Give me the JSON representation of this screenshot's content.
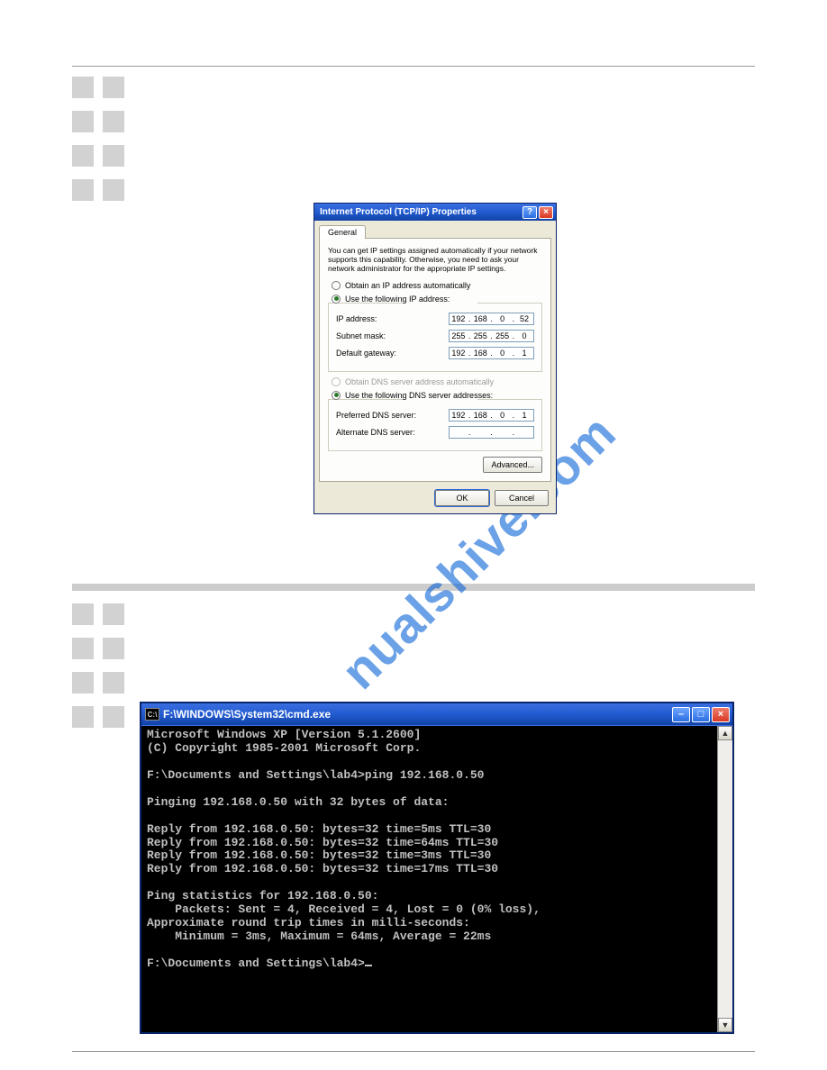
{
  "watermark": "nualshive.com",
  "tcpip": {
    "title": "Internet Protocol (TCP/IP) Properties",
    "tab": "General",
    "intro": "You can get IP settings assigned automatically if your network supports this capability. Otherwise, you need to ask your network administrator for the appropriate IP settings.",
    "r_obtain": "Obtain an IP address automatically",
    "r_usefollowing": "Use the following IP address:",
    "f_ip": "IP address:",
    "v_ip": [
      "192",
      "168",
      "0",
      "52"
    ],
    "f_mask": "Subnet mask:",
    "v_mask": [
      "255",
      "255",
      "255",
      "0"
    ],
    "f_gw": "Default gateway:",
    "v_gw": [
      "192",
      "168",
      "0",
      "1"
    ],
    "r_obtaindns": "Obtain DNS server address automatically",
    "r_usedns": "Use the following DNS server addresses:",
    "f_pref": "Preferred DNS server:",
    "v_pref": [
      "192",
      "168",
      "0",
      "1"
    ],
    "f_alt": "Alternate DNS server:",
    "v_alt": [
      "",
      "",
      "",
      ""
    ],
    "advanced": "Advanced...",
    "ok": "OK",
    "cancel": "Cancel"
  },
  "cmd": {
    "title": "F:\\WINDOWS\\System32\\cmd.exe",
    "lines": [
      "Microsoft Windows XP [Version 5.1.2600]",
      "(C) Copyright 1985-2001 Microsoft Corp.",
      "",
      "F:\\Documents and Settings\\lab4>ping 192.168.0.50",
      "",
      "Pinging 192.168.0.50 with 32 bytes of data:",
      "",
      "Reply from 192.168.0.50: bytes=32 time=5ms TTL=30",
      "Reply from 192.168.0.50: bytes=32 time=64ms TTL=30",
      "Reply from 192.168.0.50: bytes=32 time=3ms TTL=30",
      "Reply from 192.168.0.50: bytes=32 time=17ms TTL=30",
      "",
      "Ping statistics for 192.168.0.50:",
      "    Packets: Sent = 4, Received = 4, Lost = 0 (0% loss),",
      "Approximate round trip times in milli-seconds:",
      "    Minimum = 3ms, Maximum = 64ms, Average = 22ms",
      "",
      "F:\\Documents and Settings\\lab4>"
    ]
  }
}
